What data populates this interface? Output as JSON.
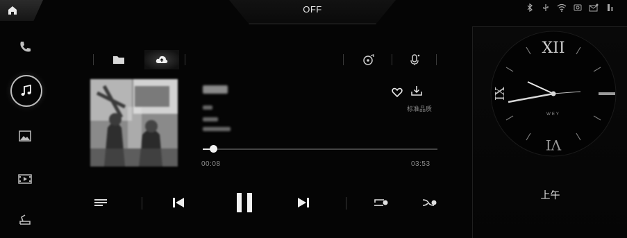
{
  "status_bar": {
    "center_label": "OFF",
    "icons": [
      "bluetooth-icon",
      "usb-icon",
      "wifi-icon",
      "sd-card-icon",
      "message-icon",
      "battery-icon"
    ]
  },
  "left_nav": {
    "items": [
      {
        "name": "phone",
        "icon": "phone-icon"
      },
      {
        "name": "music",
        "icon": "music-note-icon",
        "active": true
      },
      {
        "name": "photos",
        "icon": "image-icon"
      },
      {
        "name": "video",
        "icon": "video-icon"
      },
      {
        "name": "car-settings",
        "icon": "car-seat-icon"
      }
    ]
  },
  "player": {
    "source_tabs": [
      {
        "name": "local-files",
        "icon": "folder-icon"
      },
      {
        "name": "cloud",
        "icon": "cloud-upload-icon",
        "active": true
      }
    ],
    "right_tabs": [
      {
        "name": "audio-effects",
        "icon": "music-disc-icon"
      },
      {
        "name": "voice",
        "icon": "voice-icon"
      }
    ],
    "quality_label": "标准品质",
    "time_elapsed": "00:08",
    "time_total": "03:53",
    "progress": 0.045,
    "controls": [
      "playlist",
      "previous",
      "pause",
      "next",
      "repeat",
      "shuffle"
    ]
  },
  "clock": {
    "brand_text": "WEY",
    "period_label": "上午",
    "hour_marks": [
      "XII",
      "III",
      "VI",
      "IX"
    ]
  },
  "colors": {
    "background": "#050505",
    "active_ring": "#bdbdbd",
    "text_primary": "#e8e8e8",
    "text_secondary": "#8c8c8c"
  }
}
